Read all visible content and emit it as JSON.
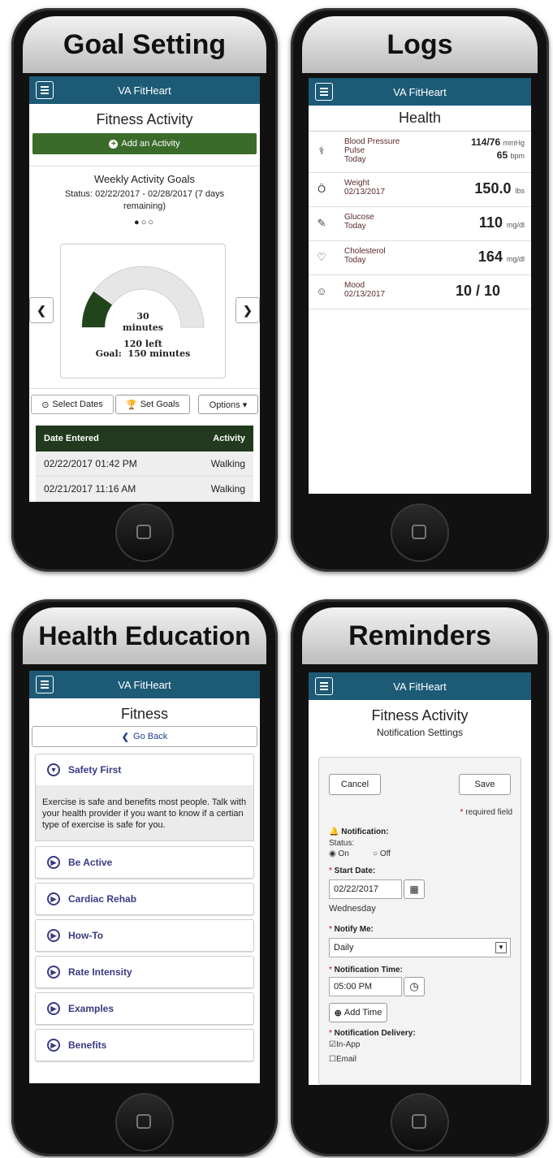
{
  "app_title": "VA FitHeart",
  "panels": {
    "goal": {
      "caption": "Goal Setting",
      "page_title": "Fitness Activity",
      "add_button": "Add an Activity",
      "weekly_title": "Weekly Activity Goals",
      "status": "Status: 02/22/2017 - 02/28/2017 (7 days remaining)",
      "dots": "●○○",
      "gauge": {
        "progress": 0.2,
        "minutes": "30",
        "minutes_unit": "minutes",
        "left": "120 left",
        "goal": "Goal:  150 minutes"
      },
      "buttons": {
        "select_dates": "Select Dates",
        "set_goals": "Set Goals",
        "options": "Options ▾"
      },
      "table": {
        "headers": [
          "Date Entered",
          "Activity"
        ],
        "rows": [
          [
            "02/22/2017 01:42 PM",
            "Walking"
          ],
          [
            "02/21/2017 11:16 AM",
            "Walking"
          ]
        ]
      }
    },
    "logs": {
      "caption": "Logs",
      "page_title": "Health",
      "rows": [
        {
          "icon": "stethoscope-icon",
          "glyph": "⚕",
          "label_lines": [
            "Blood Pressure",
            "Pulse",
            "Today"
          ],
          "value": "114/76",
          "unit": "mmHg",
          "value2": "65",
          "unit2": "bpm"
        },
        {
          "icon": "apple-icon",
          "glyph": "🍎",
          "label_lines": [
            "Weight",
            "02/13/2017"
          ],
          "value": "150.0",
          "unit": "lbs"
        },
        {
          "icon": "glucose-meter-icon",
          "glyph": "✎",
          "label_lines": [
            "Glucose",
            "Today"
          ],
          "value": "110",
          "unit": "mg/dl"
        },
        {
          "icon": "heart-icon",
          "glyph": "♡",
          "label_lines": [
            "Cholesterol",
            "Today"
          ],
          "value": "164",
          "unit": "mg/dl"
        },
        {
          "icon": "smiley-icon",
          "glyph": "☺",
          "label_lines": [
            "Mood",
            "02/13/2017"
          ],
          "value": "10 / 10",
          "unit": ""
        }
      ]
    },
    "education": {
      "caption": "Health Education",
      "page_title": "Fitness",
      "go_back": "Go Back",
      "sections": [
        {
          "label": "Safety First",
          "expanded": true,
          "body": "Exercise is safe and benefits most people. Talk with your health provider if you want to know if a certian type of exercise is safe for you."
        },
        {
          "label": "Be Active"
        },
        {
          "label": "Cardiac Rehab"
        },
        {
          "label": "How-To"
        },
        {
          "label": "Rate Intensity"
        },
        {
          "label": "Examples"
        },
        {
          "label": "Benefits"
        }
      ]
    },
    "reminders": {
      "caption": "Reminders",
      "page_title": "Fitness Activity",
      "subtitle": "Notification Settings",
      "cancel": "Cancel",
      "save": "Save",
      "required_note": "required field",
      "notification_label": "Notification:",
      "status_label": "Status:",
      "on_label": "On",
      "off_label": "Off",
      "start_date_label": "Start Date:",
      "start_date": "02/22/2017",
      "weekday": "Wednesday",
      "notify_me_label": "Notify Me:",
      "notify_me_value": "Daily",
      "time_label": "Notification Time:",
      "time_value": "05:00 PM",
      "add_time": "Add Time",
      "delivery_label": "Notification Delivery:",
      "inapp_label": "In-App",
      "email_label": "Email"
    }
  }
}
